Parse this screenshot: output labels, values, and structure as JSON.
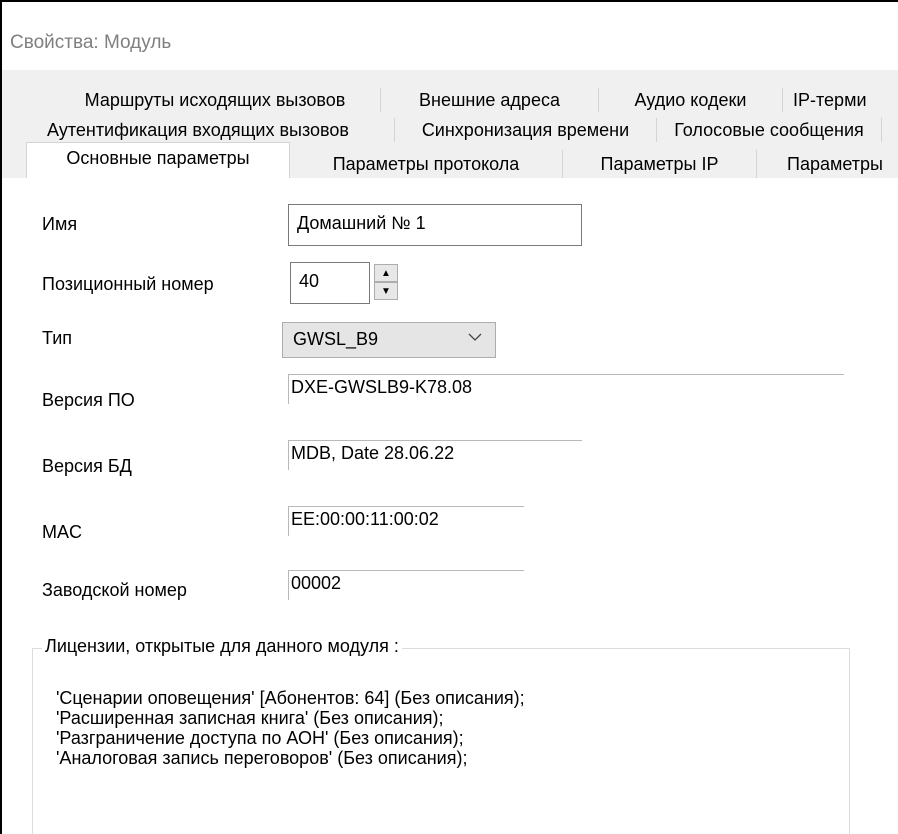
{
  "window": {
    "title": "Свойства: Модуль"
  },
  "tabs": {
    "row1": [
      "Маршруты исходящих вызовов",
      "Внешние адреса",
      "Аудио кодеки",
      "IP-терми"
    ],
    "row2": [
      "Аутентификация входящих вызовов",
      "Синхронизация времени",
      "Голосовые сообщения"
    ],
    "row3": [
      "Основные параметры",
      "Параметры протокола",
      "Параметры IP",
      "Параметры"
    ],
    "selected": "Основные параметры"
  },
  "form": {
    "name_label": "Имя",
    "name_value": "Домашний № 1",
    "position_label": "Позиционный номер",
    "position_value": "40",
    "type_label": "Тип",
    "type_value": "GWSL_B9",
    "sw_version_label": "Версия ПО",
    "sw_version_value": "DXE-GWSLB9-K78.08",
    "db_version_label": "Версия БД",
    "db_version_value": "MDB, Date 28.06.22",
    "mac_label": "MAC",
    "mac_value": "EE:00:00:11:00:02",
    "serial_label": "Заводской номер",
    "serial_value": "00002"
  },
  "licenses": {
    "title": "Лицензии, открытые для данного модуля :",
    "items": [
      "'Сценарии оповещения' [Абонентов: 64] (Без описания);",
      "'Расширенная записная книга' (Без описания);",
      "'Разграничение доступа по АОН' (Без описания);",
      "'Аналоговая запись переговоров' (Без описания);"
    ]
  },
  "icons": {
    "spin_up": "triangle-up-icon",
    "spin_down": "triangle-down-icon",
    "dropdown": "chevron-down-icon"
  },
  "colors": {
    "tab_background": "#f0f0f0",
    "title_text": "#7f7f7f"
  }
}
